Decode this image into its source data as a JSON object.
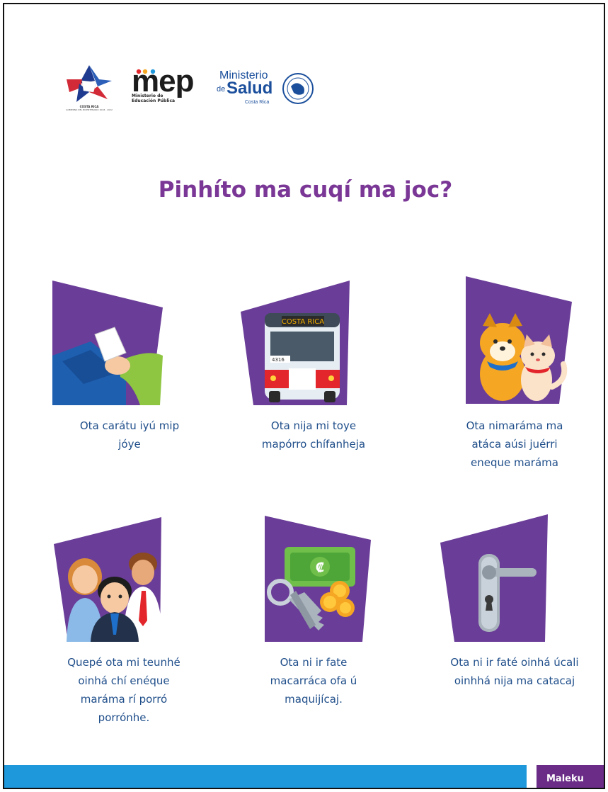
{
  "header": {
    "cr_logo_text": "COSTA RICA",
    "cr_logo_sub": "GOBIERNO DEL BICENTENARIO 2018 - 2022",
    "mep_word": "mep",
    "mep_sub_line1": "Ministerio de",
    "mep_sub_line2": "Educación Pública",
    "salud_line1": "Ministerio",
    "salud_de": "de",
    "salud_word": "Salud",
    "salud_country": "Costa Rica"
  },
  "title": "Pinhíto ma cuqí ma joc?",
  "cards": [
    {
      "icon": "cleaning-surface-icon",
      "lines": [
        "Ota carátu iyú mip",
        "jóye"
      ]
    },
    {
      "icon": "bus-icon",
      "bus_sign": "COSTA RICA",
      "bus_number": "4316",
      "lines": [
        "Ota nija mi toye",
        "mapórro chífanheja"
      ]
    },
    {
      "icon": "pets-icon",
      "lines": [
        "Ota nimaráma ma",
        "atáca aúsi juérri",
        "eneque maráma"
      ]
    },
    {
      "icon": "people-icon",
      "lines": [
        "Quepé ota mi teunhé",
        "oinhá chí enéque",
        "maráma rí porró",
        "porrónhe."
      ]
    },
    {
      "icon": "money-keys-icon",
      "currency_symbol": "₡",
      "lines": [
        "Ota ni ir fate",
        "macarráca ofa ú",
        "maquijícaj."
      ]
    },
    {
      "icon": "door-handle-icon",
      "lines": [
        "Ota ni ir faté oinhá úcali",
        "oinhhá nija ma catacaj"
      ]
    }
  ],
  "footer": {
    "language_tag": "Maleku"
  },
  "colors": {
    "purple": "#6a3d98",
    "title": "#7a3796",
    "caption": "#1f4e8a",
    "footer_blue": "#1e97db",
    "footer_tag": "#6a2c87"
  }
}
